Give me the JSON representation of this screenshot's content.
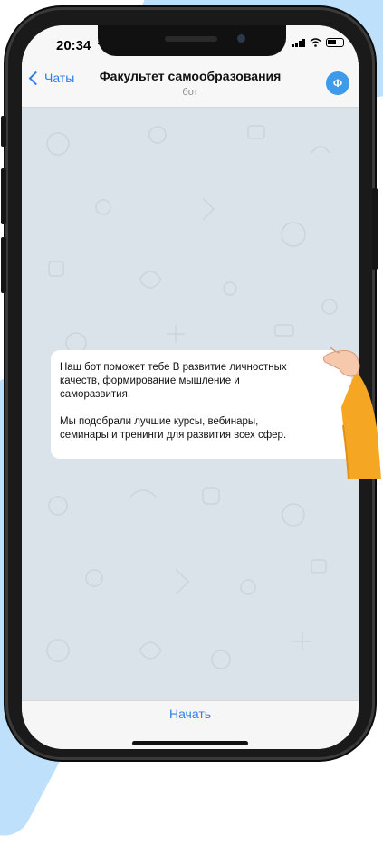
{
  "status": {
    "time": "20:34"
  },
  "nav": {
    "back_label": "Чаты",
    "title": "Факультет самообразования",
    "subtitle": "бот",
    "avatar_letter": "Ф"
  },
  "message": {
    "line1": "Наш бот поможет тебе В развитие личностных",
    "line2": "качеств, формирование мышление и",
    "line3": "саморазвития.",
    "line4": "Мы подобрали лучшие курсы, вебинары,",
    "line5": "семинары и тренинги для развития всех сфер."
  },
  "bottom": {
    "start_label": "Начать"
  },
  "colors": {
    "accent": "#2f7fe8",
    "avatar_bg": "#3d9be9",
    "chat_bg": "#dbe3ea",
    "deco_blue": "#bfe0fb"
  },
  "icons": [
    "back-chevron-icon",
    "signal-icon",
    "wifi-icon",
    "battery-icon",
    "location-arrow-icon"
  ]
}
